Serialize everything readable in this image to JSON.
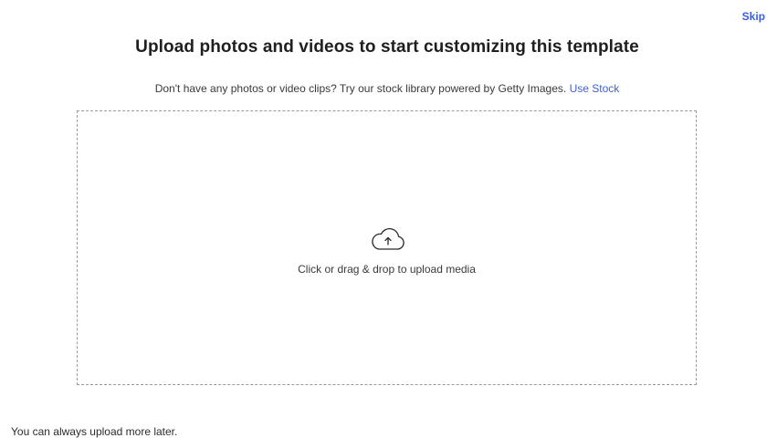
{
  "header": {
    "skip_label": "Skip",
    "title": "Upload photos and videos to start customizing this template"
  },
  "subtitle": {
    "text": "Don't have any photos or video clips? Try our stock library powered by Getty Images.",
    "link_label": "Use Stock"
  },
  "dropzone": {
    "icon": "cloud-upload-icon",
    "prompt": "Click or drag & drop to upload media"
  },
  "footer": {
    "note": "You can always upload more later."
  },
  "colors": {
    "accent": "#3b5fd9",
    "text": "#2b2b2b",
    "border": "#9a9a9a"
  }
}
